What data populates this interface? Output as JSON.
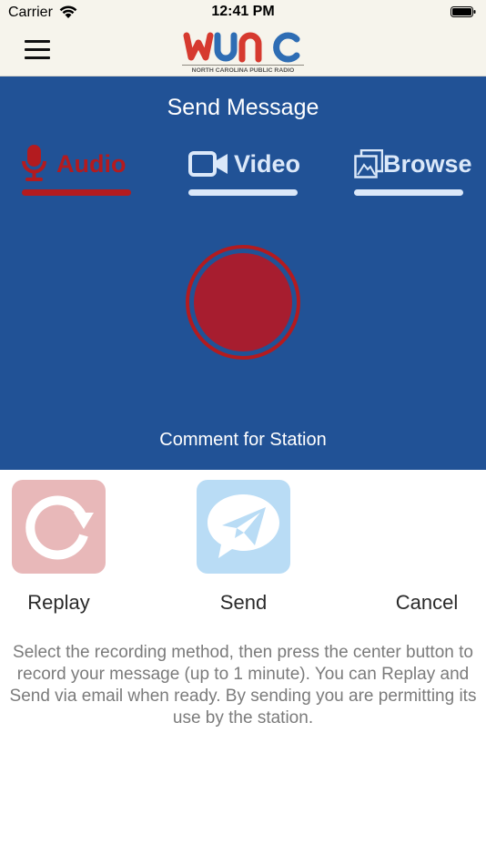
{
  "status_bar": {
    "carrier": "Carrier",
    "time": "12:41 PM"
  },
  "header": {
    "logo_text": "WUNC",
    "logo_subtitle": "NORTH CAROLINA PUBLIC RADIO",
    "logo_colors": [
      "#d63a2f",
      "#2e6db4",
      "#d63a2f",
      "#2e6db4"
    ]
  },
  "panel": {
    "title": "Send Message",
    "tabs": [
      {
        "label": "Audio",
        "icon": "microphone-icon",
        "selected": true
      },
      {
        "label": "Video",
        "icon": "video-camera-icon",
        "selected": false
      },
      {
        "label": "Browse",
        "icon": "gallery-icon",
        "selected": false
      }
    ],
    "station_label": "Comment for Station"
  },
  "actions": {
    "replay_label": "Replay",
    "send_label": "Send",
    "cancel_label": "Cancel"
  },
  "instructions": "Select the recording method, then press the center button to record your message (up to 1 minute). You can Replay and Send via email when ready. By sending you are permitting its use by the station.",
  "colors": {
    "panel_blue": "#215296",
    "accent_red": "#b31b1f",
    "record_red": "#a71d2f",
    "tab_inactive": "#dbe8f9",
    "header_bg": "#f6f4ec"
  }
}
